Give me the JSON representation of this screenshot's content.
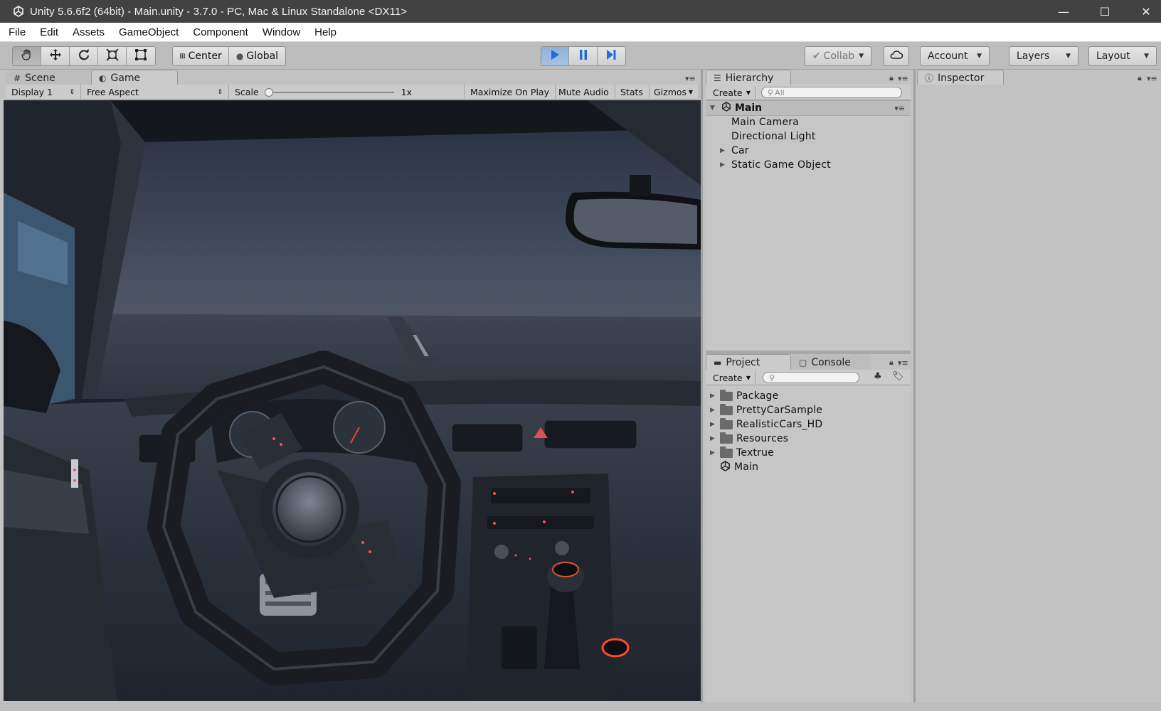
{
  "window": {
    "title": "Unity 5.6.6f2 (64bit) - Main.unity - 3.7.0 - PC, Mac & Linux Standalone <DX11>",
    "controls": {
      "minimize": "—",
      "maximize": "☐",
      "close": "✕"
    }
  },
  "menu": [
    "File",
    "Edit",
    "Assets",
    "GameObject",
    "Component",
    "Window",
    "Help"
  ],
  "toolbar": {
    "pivot_label": "Center",
    "space_label": "Global",
    "collab_label": "Collab",
    "account_label": "Account",
    "layers_label": "Layers",
    "layout_label": "Layout"
  },
  "scene_tabs": {
    "scene": "Scene",
    "game": "Game"
  },
  "game_view": {
    "display": "Display 1",
    "aspect": "Free Aspect",
    "scale_label": "Scale",
    "scale_value": "1x",
    "maximize_on_play": "Maximize On Play",
    "mute_audio": "Mute Audio",
    "stats": "Stats",
    "gizmos": "Gizmos"
  },
  "hierarchy": {
    "tab": "Hierarchy",
    "create": "Create",
    "search_placeholder": "All",
    "scene": "Main",
    "items": [
      "Main Camera",
      "Directional Light",
      "Car",
      "Static Game Object"
    ]
  },
  "project": {
    "tab": "Project",
    "console_tab": "Console",
    "create": "Create",
    "items": [
      "Package",
      "PrettyCarSample",
      "RealisticCars_HD",
      "Resources",
      "Textrue",
      "Main"
    ]
  },
  "inspector": {
    "tab": "Inspector"
  },
  "colors": {
    "titlebar": "#424242",
    "panel": "#c2c2c2",
    "play_active": "#8fb0d8",
    "play_icon": "#1f6fd6"
  }
}
